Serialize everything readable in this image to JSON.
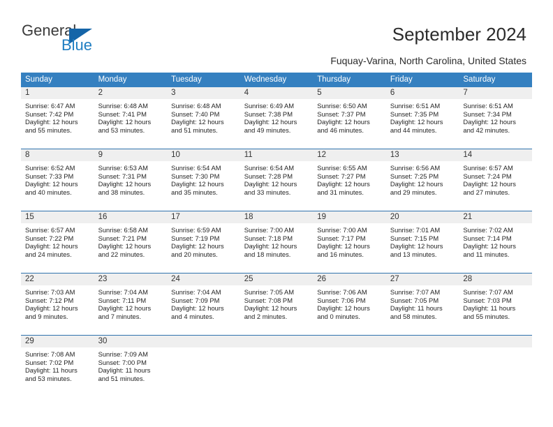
{
  "brand": {
    "name_part1": "General",
    "name_part2": "Blue",
    "accent_color": "#1565a8",
    "logo_icon": "triangle-flag-icon"
  },
  "header": {
    "title": "September 2024",
    "subtitle": "Fuquay-Varina, North Carolina, United States"
  },
  "calendar": {
    "header_bg": "#3580c0",
    "day_band_bg": "#efefef",
    "row_divider_color": "#2f72ad",
    "weekdays": [
      "Sunday",
      "Monday",
      "Tuesday",
      "Wednesday",
      "Thursday",
      "Friday",
      "Saturday"
    ],
    "weeks": [
      [
        {
          "day": "1",
          "sunrise": "Sunrise: 6:47 AM",
          "sunset": "Sunset: 7:42 PM",
          "daylight_line1": "Daylight: 12 hours",
          "daylight_line2": "and 55 minutes."
        },
        {
          "day": "2",
          "sunrise": "Sunrise: 6:48 AM",
          "sunset": "Sunset: 7:41 PM",
          "daylight_line1": "Daylight: 12 hours",
          "daylight_line2": "and 53 minutes."
        },
        {
          "day": "3",
          "sunrise": "Sunrise: 6:48 AM",
          "sunset": "Sunset: 7:40 PM",
          "daylight_line1": "Daylight: 12 hours",
          "daylight_line2": "and 51 minutes."
        },
        {
          "day": "4",
          "sunrise": "Sunrise: 6:49 AM",
          "sunset": "Sunset: 7:38 PM",
          "daylight_line1": "Daylight: 12 hours",
          "daylight_line2": "and 49 minutes."
        },
        {
          "day": "5",
          "sunrise": "Sunrise: 6:50 AM",
          "sunset": "Sunset: 7:37 PM",
          "daylight_line1": "Daylight: 12 hours",
          "daylight_line2": "and 46 minutes."
        },
        {
          "day": "6",
          "sunrise": "Sunrise: 6:51 AM",
          "sunset": "Sunset: 7:35 PM",
          "daylight_line1": "Daylight: 12 hours",
          "daylight_line2": "and 44 minutes."
        },
        {
          "day": "7",
          "sunrise": "Sunrise: 6:51 AM",
          "sunset": "Sunset: 7:34 PM",
          "daylight_line1": "Daylight: 12 hours",
          "daylight_line2": "and 42 minutes."
        }
      ],
      [
        {
          "day": "8",
          "sunrise": "Sunrise: 6:52 AM",
          "sunset": "Sunset: 7:33 PM",
          "daylight_line1": "Daylight: 12 hours",
          "daylight_line2": "and 40 minutes."
        },
        {
          "day": "9",
          "sunrise": "Sunrise: 6:53 AM",
          "sunset": "Sunset: 7:31 PM",
          "daylight_line1": "Daylight: 12 hours",
          "daylight_line2": "and 38 minutes."
        },
        {
          "day": "10",
          "sunrise": "Sunrise: 6:54 AM",
          "sunset": "Sunset: 7:30 PM",
          "daylight_line1": "Daylight: 12 hours",
          "daylight_line2": "and 35 minutes."
        },
        {
          "day": "11",
          "sunrise": "Sunrise: 6:54 AM",
          "sunset": "Sunset: 7:28 PM",
          "daylight_line1": "Daylight: 12 hours",
          "daylight_line2": "and 33 minutes."
        },
        {
          "day": "12",
          "sunrise": "Sunrise: 6:55 AM",
          "sunset": "Sunset: 7:27 PM",
          "daylight_line1": "Daylight: 12 hours",
          "daylight_line2": "and 31 minutes."
        },
        {
          "day": "13",
          "sunrise": "Sunrise: 6:56 AM",
          "sunset": "Sunset: 7:25 PM",
          "daylight_line1": "Daylight: 12 hours",
          "daylight_line2": "and 29 minutes."
        },
        {
          "day": "14",
          "sunrise": "Sunrise: 6:57 AM",
          "sunset": "Sunset: 7:24 PM",
          "daylight_line1": "Daylight: 12 hours",
          "daylight_line2": "and 27 minutes."
        }
      ],
      [
        {
          "day": "15",
          "sunrise": "Sunrise: 6:57 AM",
          "sunset": "Sunset: 7:22 PM",
          "daylight_line1": "Daylight: 12 hours",
          "daylight_line2": "and 24 minutes."
        },
        {
          "day": "16",
          "sunrise": "Sunrise: 6:58 AM",
          "sunset": "Sunset: 7:21 PM",
          "daylight_line1": "Daylight: 12 hours",
          "daylight_line2": "and 22 minutes."
        },
        {
          "day": "17",
          "sunrise": "Sunrise: 6:59 AM",
          "sunset": "Sunset: 7:19 PM",
          "daylight_line1": "Daylight: 12 hours",
          "daylight_line2": "and 20 minutes."
        },
        {
          "day": "18",
          "sunrise": "Sunrise: 7:00 AM",
          "sunset": "Sunset: 7:18 PM",
          "daylight_line1": "Daylight: 12 hours",
          "daylight_line2": "and 18 minutes."
        },
        {
          "day": "19",
          "sunrise": "Sunrise: 7:00 AM",
          "sunset": "Sunset: 7:17 PM",
          "daylight_line1": "Daylight: 12 hours",
          "daylight_line2": "and 16 minutes."
        },
        {
          "day": "20",
          "sunrise": "Sunrise: 7:01 AM",
          "sunset": "Sunset: 7:15 PM",
          "daylight_line1": "Daylight: 12 hours",
          "daylight_line2": "and 13 minutes."
        },
        {
          "day": "21",
          "sunrise": "Sunrise: 7:02 AM",
          "sunset": "Sunset: 7:14 PM",
          "daylight_line1": "Daylight: 12 hours",
          "daylight_line2": "and 11 minutes."
        }
      ],
      [
        {
          "day": "22",
          "sunrise": "Sunrise: 7:03 AM",
          "sunset": "Sunset: 7:12 PM",
          "daylight_line1": "Daylight: 12 hours",
          "daylight_line2": "and 9 minutes."
        },
        {
          "day": "23",
          "sunrise": "Sunrise: 7:04 AM",
          "sunset": "Sunset: 7:11 PM",
          "daylight_line1": "Daylight: 12 hours",
          "daylight_line2": "and 7 minutes."
        },
        {
          "day": "24",
          "sunrise": "Sunrise: 7:04 AM",
          "sunset": "Sunset: 7:09 PM",
          "daylight_line1": "Daylight: 12 hours",
          "daylight_line2": "and 4 minutes."
        },
        {
          "day": "25",
          "sunrise": "Sunrise: 7:05 AM",
          "sunset": "Sunset: 7:08 PM",
          "daylight_line1": "Daylight: 12 hours",
          "daylight_line2": "and 2 minutes."
        },
        {
          "day": "26",
          "sunrise": "Sunrise: 7:06 AM",
          "sunset": "Sunset: 7:06 PM",
          "daylight_line1": "Daylight: 12 hours",
          "daylight_line2": "and 0 minutes."
        },
        {
          "day": "27",
          "sunrise": "Sunrise: 7:07 AM",
          "sunset": "Sunset: 7:05 PM",
          "daylight_line1": "Daylight: 11 hours",
          "daylight_line2": "and 58 minutes."
        },
        {
          "day": "28",
          "sunrise": "Sunrise: 7:07 AM",
          "sunset": "Sunset: 7:03 PM",
          "daylight_line1": "Daylight: 11 hours",
          "daylight_line2": "and 55 minutes."
        }
      ],
      [
        {
          "day": "29",
          "sunrise": "Sunrise: 7:08 AM",
          "sunset": "Sunset: 7:02 PM",
          "daylight_line1": "Daylight: 11 hours",
          "daylight_line2": "and 53 minutes."
        },
        {
          "day": "30",
          "sunrise": "Sunrise: 7:09 AM",
          "sunset": "Sunset: 7:00 PM",
          "daylight_line1": "Daylight: 11 hours",
          "daylight_line2": "and 51 minutes."
        },
        {
          "day": "",
          "sunrise": "",
          "sunset": "",
          "daylight_line1": "",
          "daylight_line2": ""
        },
        {
          "day": "",
          "sunrise": "",
          "sunset": "",
          "daylight_line1": "",
          "daylight_line2": ""
        },
        {
          "day": "",
          "sunrise": "",
          "sunset": "",
          "daylight_line1": "",
          "daylight_line2": ""
        },
        {
          "day": "",
          "sunrise": "",
          "sunset": "",
          "daylight_line1": "",
          "daylight_line2": ""
        },
        {
          "day": "",
          "sunrise": "",
          "sunset": "",
          "daylight_line1": "",
          "daylight_line2": ""
        }
      ]
    ]
  }
}
